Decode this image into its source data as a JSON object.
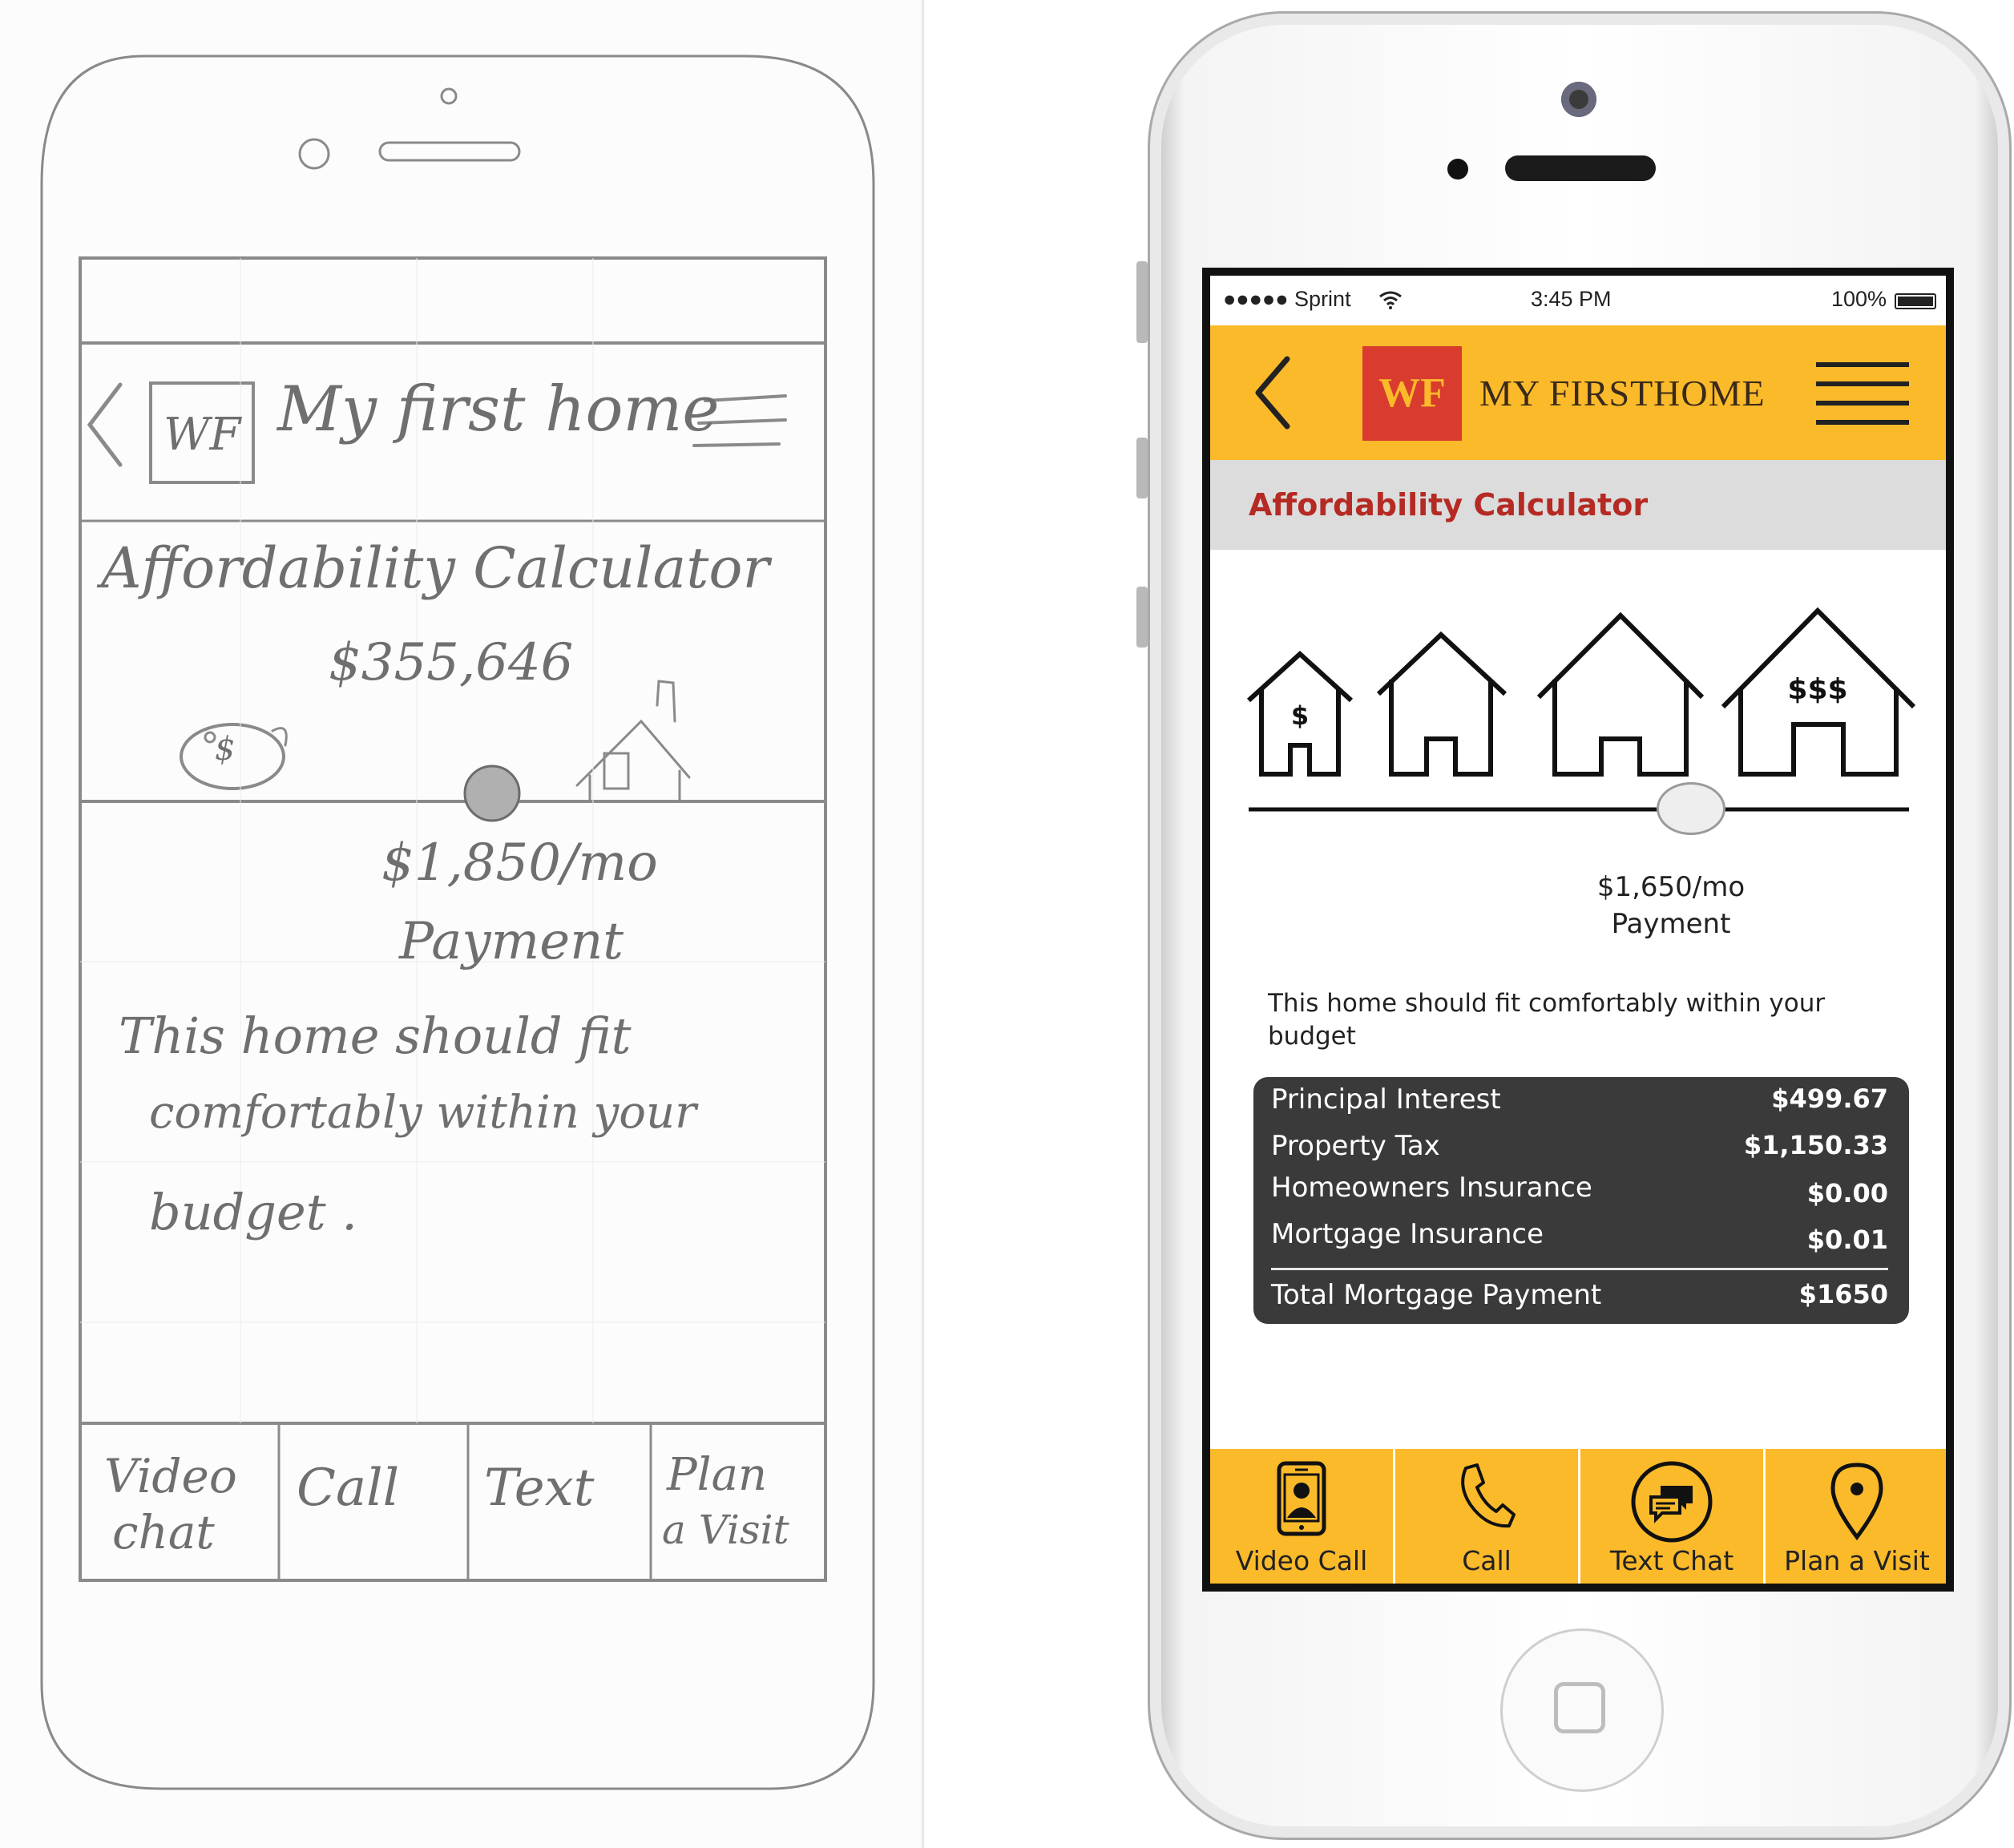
{
  "sketch": {
    "header": "My first home",
    "logo": "WF",
    "section_title": "Affordability Calculator",
    "amount": "$355,646",
    "payment_amount": "$1,850/mo",
    "payment_label": "Payment",
    "message_lines": [
      "This home should fit",
      "comfortably within your",
      "budget ."
    ],
    "tabs": [
      {
        "line1": "Video",
        "line2": "chat"
      },
      {
        "line1": "Call",
        "line2": ""
      },
      {
        "line1": "Text",
        "line2": ""
      },
      {
        "line1": "Plan",
        "line2": "a Visit"
      }
    ]
  },
  "app": {
    "status": {
      "carrier": "●●●●● Sprint",
      "time": "3:45 PM",
      "battery": "100%"
    },
    "logo": "WF",
    "title": "MY FIRSTHOME",
    "section_title": "Affordability Calculator",
    "house_labels": [
      "$",
      "",
      "",
      "$$$"
    ],
    "slider_value": 0.67,
    "payment_amount": "$1,650/mo",
    "payment_label": "Payment",
    "message": "This home should fit comfortably within your budget",
    "breakdown": [
      {
        "label": "Principal Interest",
        "value": "$499.67"
      },
      {
        "label": "Property Tax",
        "value": "$1,150.33"
      },
      {
        "label": "Homeowners Insurance",
        "value": "$0.00"
      },
      {
        "label": "Mortgage Insurance",
        "value": "$0.01"
      }
    ],
    "total": {
      "label": "Total Mortgage Payment",
      "value": "$1650"
    },
    "tabs": [
      {
        "label": "Video Call",
        "icon": "video-call-icon"
      },
      {
        "label": "Call",
        "icon": "phone-icon"
      },
      {
        "label": "Text Chat",
        "icon": "chat-bubbles-icon"
      },
      {
        "label": "Plan a Visit",
        "icon": "map-pin-icon"
      }
    ],
    "colors": {
      "accent": "#fbba2a",
      "brand_red": "#d93b2f",
      "title_red": "#b52a23",
      "panel": "#3a3a3a"
    }
  }
}
